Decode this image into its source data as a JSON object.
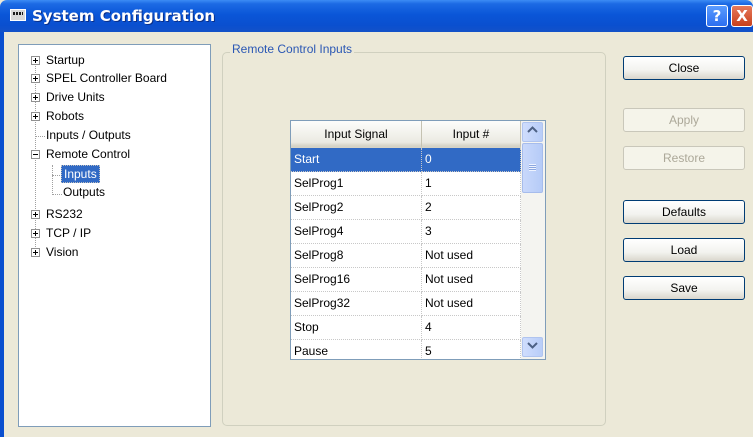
{
  "window": {
    "title": "System Configuration",
    "help_label": "?",
    "close_label": "X"
  },
  "tree": {
    "items": [
      {
        "label": "Startup",
        "expander": "plus"
      },
      {
        "label": "SPEL Controller Board",
        "expander": "plus"
      },
      {
        "label": "Drive Units",
        "expander": "plus"
      },
      {
        "label": "Robots",
        "expander": "plus"
      },
      {
        "label": "Inputs / Outputs",
        "expander": "none"
      },
      {
        "label": "Remote Control",
        "expander": "minus"
      },
      {
        "label": "Inputs",
        "expander": "none",
        "selected": true
      },
      {
        "label": "Outputs",
        "expander": "none"
      },
      {
        "label": "RS232",
        "expander": "plus"
      },
      {
        "label": "TCP / IP",
        "expander": "plus"
      },
      {
        "label": "Vision",
        "expander": "plus"
      }
    ]
  },
  "group": {
    "label": "Remote Control Inputs"
  },
  "grid": {
    "columns": [
      "Input Signal",
      "Input #"
    ],
    "rows": [
      [
        "Start",
        "0"
      ],
      [
        "SelProg1",
        "1"
      ],
      [
        "SelProg2",
        "2"
      ],
      [
        "SelProg4",
        "3"
      ],
      [
        "SelProg8",
        "Not used"
      ],
      [
        "SelProg16",
        "Not used"
      ],
      [
        "SelProg32",
        "Not used"
      ],
      [
        "Stop",
        "4"
      ],
      [
        "Pause",
        "5"
      ]
    ],
    "selected_row": 0,
    "scroll_up_icon": "chevron-up-icon",
    "scroll_down_icon": "chevron-down-icon"
  },
  "buttons": {
    "close": "Close",
    "apply": "Apply",
    "restore": "Restore",
    "defaults": "Defaults",
    "load": "Load",
    "save": "Save"
  },
  "colors": {
    "title_bar": "#0a56d8",
    "selection": "#316ac5",
    "group_label": "#2a57b4"
  }
}
